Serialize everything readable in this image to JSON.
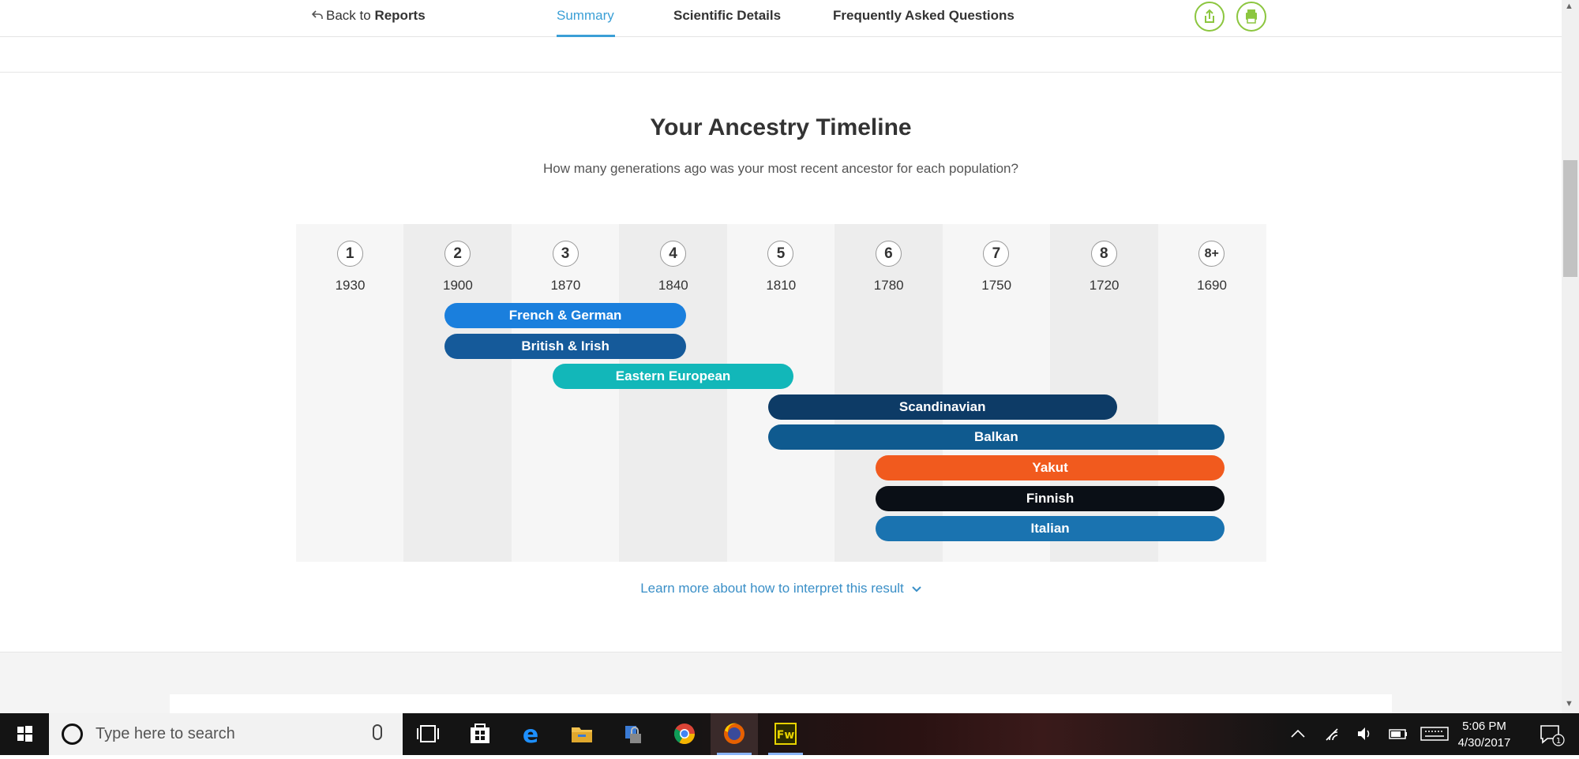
{
  "nav": {
    "back_prefix": "Back to",
    "back_target": "Reports",
    "tabs": [
      "Summary",
      "Scientific Details",
      "Frequently Asked Questions"
    ],
    "active_tab": "Summary",
    "icons": [
      "share-icon",
      "print-icon"
    ],
    "accent_color": "#8cc63f",
    "link_color": "#3a9fd6"
  },
  "timeline": {
    "title": "Your Ancestry Timeline",
    "subtitle": "How many generations ago was your most recent ancestor for each population?",
    "generations": [
      {
        "label": "1",
        "year": "1930"
      },
      {
        "label": "2",
        "year": "1900"
      },
      {
        "label": "3",
        "year": "1870"
      },
      {
        "label": "4",
        "year": "1840"
      },
      {
        "label": "5",
        "year": "1810"
      },
      {
        "label": "6",
        "year": "1780"
      },
      {
        "label": "7",
        "year": "1750"
      },
      {
        "label": "8",
        "year": "1720"
      },
      {
        "label": "8+",
        "year": "1690"
      }
    ],
    "populations": [
      {
        "name": "French & German",
        "from_generation": 2,
        "to_generation": 4,
        "color": "#1a7fdd"
      },
      {
        "name": "British & Irish",
        "from_generation": 2,
        "to_generation": 4,
        "color": "#155a9a"
      },
      {
        "name": "Eastern European",
        "from_generation": 3,
        "to_generation": 5,
        "color": "#12b7b9"
      },
      {
        "name": "Scandinavian",
        "from_generation": 5,
        "to_generation": 8,
        "color": "#0d3b66"
      },
      {
        "name": "Balkan",
        "from_generation": 5,
        "to_generation": 9,
        "color": "#0f5a8f"
      },
      {
        "name": "Yakut",
        "from_generation": 6,
        "to_generation": 9,
        "color": "#f15a1e"
      },
      {
        "name": "Finnish",
        "from_generation": 6,
        "to_generation": 9,
        "color": "#0a0f16"
      },
      {
        "name": "Italian",
        "from_generation": 6,
        "to_generation": 9,
        "color": "#1a73b0"
      }
    ],
    "learn_more": "Learn more about how to interpret this result"
  },
  "taskbar": {
    "search_placeholder": "Type here to search",
    "apps": [
      "task-view-icon",
      "store-icon",
      "edge-icon",
      "file-explorer-icon",
      "lock-app-icon",
      "chrome-icon",
      "firefox-icon",
      "fireworks-icon"
    ],
    "fireworks_label": "Fw",
    "time": "5:06 PM",
    "date": "4/30/2017",
    "notification_count": "1"
  }
}
